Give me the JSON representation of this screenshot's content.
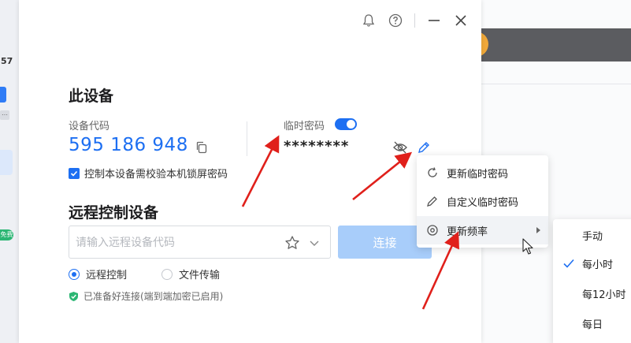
{
  "left_strip": {
    "text_top": "57",
    "badge": "免费"
  },
  "titlebar": {
    "icons": [
      "bell-icon",
      "help-icon",
      "minimize-icon",
      "close-icon"
    ]
  },
  "this_device": {
    "title": "此设备",
    "code_label": "设备代码",
    "code_value": "595 186 948",
    "temp_password_label": "临时密码",
    "temp_password_enabled": true,
    "password_masked": "********",
    "lock_checkbox_label": "控制本设备需校验本机锁屏密码",
    "lock_checkbox_checked": true
  },
  "remote": {
    "title": "远程控制设备",
    "input_placeholder": "请输入远程设备代码",
    "connect_label": "连接",
    "mode_remote": "远程控制",
    "mode_file": "文件传输",
    "selected_mode": "远程控制",
    "status_text": "已准备好连接(端到端加密已启用)"
  },
  "context_menu": {
    "items": [
      {
        "label": "更新临时密码",
        "icon": "refresh-icon"
      },
      {
        "label": "自定义临时密码",
        "icon": "pencil-icon"
      },
      {
        "label": "更新频率",
        "icon": "frequency-icon",
        "has_submenu": true
      }
    ]
  },
  "frequency_submenu": {
    "items": [
      "手动",
      "每小时",
      "每12小时",
      "每日"
    ],
    "selected": "每小时"
  },
  "colors": {
    "accent": "#1d6ff2",
    "connect_disabled": "#a8cdfa",
    "annotation_arrow": "#e0201b",
    "success": "#2bb673"
  }
}
